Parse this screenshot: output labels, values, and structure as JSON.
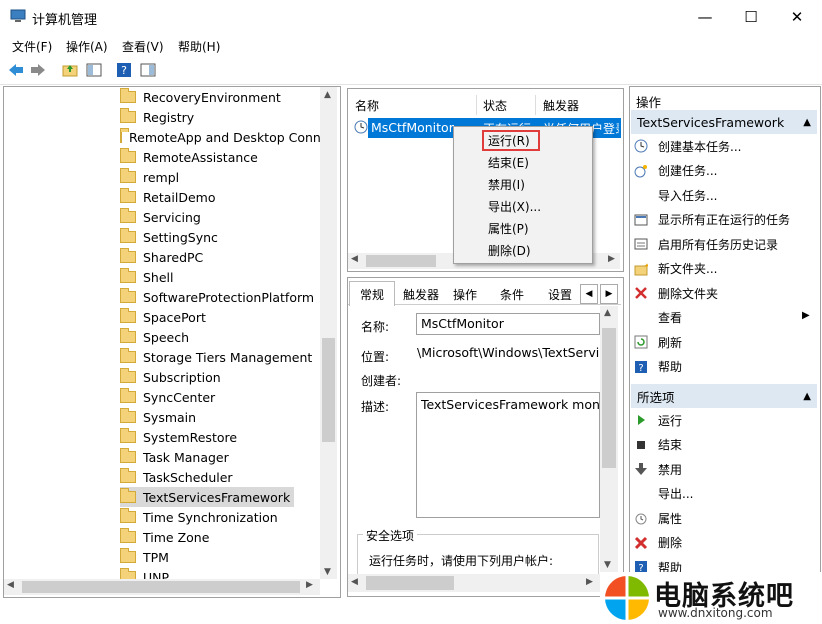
{
  "window": {
    "title": "计算机管理"
  },
  "menu": [
    "文件(F)",
    "操作(A)",
    "查看(V)",
    "帮助(H)"
  ],
  "tree": {
    "items": [
      "RecoveryEnvironment",
      "Registry",
      "RemoteApp and Desktop Conn",
      "RemoteAssistance",
      "rempl",
      "RetailDemo",
      "Servicing",
      "SettingSync",
      "SharedPC",
      "Shell",
      "SoftwareProtectionPlatform",
      "SpacePort",
      "Speech",
      "Storage Tiers Management",
      "Subscription",
      "SyncCenter",
      "Sysmain",
      "SystemRestore",
      "Task Manager",
      "TaskScheduler",
      "TextServicesFramework",
      "Time Synchronization",
      "Time Zone",
      "TPM",
      "UNP"
    ],
    "selected_index": 20
  },
  "task_list": {
    "columns": [
      "名称",
      "状态",
      "触发器"
    ],
    "row": {
      "name": "MsCtfMonitor",
      "status": "正在运行",
      "trigger": "当任何用户登录"
    }
  },
  "context_menu": {
    "items": [
      "运行(R)",
      "结束(E)",
      "禁用(I)",
      "导出(X)...",
      "属性(P)",
      "删除(D)"
    ],
    "highlighted_index": 0
  },
  "detail_tabs": [
    "常规",
    "触发器",
    "操作",
    "条件",
    "设置"
  ],
  "details": {
    "name_label": "名称:",
    "name_value": "MsCtfMonitor",
    "location_label": "位置:",
    "location_value": "\\Microsoft\\Windows\\TextServic",
    "author_label": "创建者:",
    "desc_label": "描述:",
    "desc_value": "TextServicesFramework monito",
    "security_title": "安全选项",
    "security_text": "运行任务时，请使用下列用户帐户:"
  },
  "actions": {
    "header": "操作",
    "section1_title": "TextServicesFramework",
    "section1_items": [
      {
        "label": "创建基本任务...",
        "icon": "create-basic-task-icon"
      },
      {
        "label": "创建任务...",
        "icon": "create-task-icon"
      },
      {
        "label": "导入任务...",
        "icon": ""
      },
      {
        "label": "显示所有正在运行的任务",
        "icon": "running-tasks-icon"
      },
      {
        "label": "启用所有任务历史记录",
        "icon": "history-icon"
      },
      {
        "label": "新文件夹...",
        "icon": "new-folder-icon"
      },
      {
        "label": "删除文件夹",
        "icon": "delete-folder-icon"
      },
      {
        "label": "查看",
        "icon": ""
      },
      {
        "label": "刷新",
        "icon": "refresh-icon"
      },
      {
        "label": "帮助",
        "icon": "help-icon"
      }
    ],
    "section2_title": "所选项",
    "section2_items": [
      {
        "label": "运行",
        "icon": "run-icon"
      },
      {
        "label": "结束",
        "icon": "stop-icon"
      },
      {
        "label": "禁用",
        "icon": "disable-icon"
      },
      {
        "label": "导出...",
        "icon": ""
      },
      {
        "label": "属性",
        "icon": "properties-icon"
      },
      {
        "label": "删除",
        "icon": "delete-icon"
      },
      {
        "label": "帮助",
        "icon": "help-icon"
      }
    ]
  },
  "watermark": {
    "title": "电脑系统吧",
    "url": "www.dnxitong.com"
  },
  "colors": {
    "selection": "#0078d7",
    "header_bg": "#dde8f3",
    "highlight_border": "#e03c3c"
  }
}
